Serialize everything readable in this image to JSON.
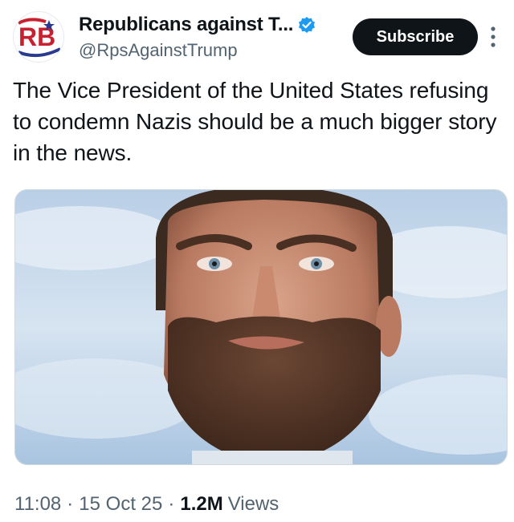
{
  "account": {
    "display_name": "Republicans against T...",
    "handle": "@RpsAgainstTrump",
    "avatar_initials": "RB",
    "verified_icon": "verified-badge-icon",
    "verified_color": "#1d9bf0"
  },
  "actions": {
    "subscribe_label": "Subscribe",
    "more_icon": "more-vertical-icon"
  },
  "post": {
    "text": "The Vice President of the United States refusing to condemn Nazis should be a much bigger story in the news."
  },
  "meta": {
    "time": "11:08",
    "separator": "·",
    "date": "15 Oct 25",
    "views_count": "1.2M",
    "views_label": "Views"
  },
  "colors": {
    "text_primary": "#0f1419",
    "text_secondary": "#536471",
    "button_bg": "#0f1419",
    "avatar_red": "#c8202f",
    "avatar_blue": "#2a3b8f",
    "sky": "#c9dcef"
  }
}
